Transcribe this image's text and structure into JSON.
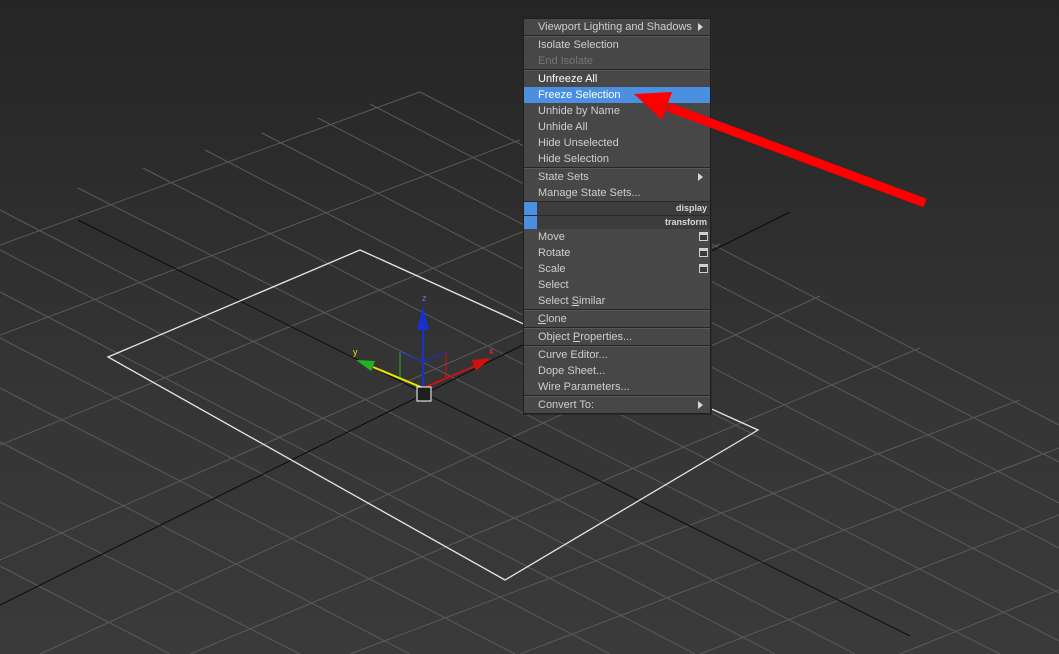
{
  "viewport": {
    "axis_labels": {
      "x": "x",
      "y": "y",
      "z": "z"
    },
    "colors": {
      "grid": "#5a5a5a",
      "world_axis": "#0a0a0a",
      "plane": "#e6e6e6",
      "x_axis": "#d01010",
      "y_axis": "#22b322",
      "z_axis": "#1a2fd0",
      "arrow": "#ff0000"
    }
  },
  "quad_menu": {
    "items": [
      {
        "type": "item",
        "label": "Viewport Lighting and Shadows",
        "submenu": true,
        "state": "normal"
      },
      {
        "type": "sep"
      },
      {
        "type": "item",
        "label": "Isolate Selection",
        "state": "normal"
      },
      {
        "type": "item",
        "label": "End Isolate",
        "state": "disabled"
      },
      {
        "type": "sep"
      },
      {
        "type": "item",
        "label": "Unfreeze All",
        "state": "bright"
      },
      {
        "type": "item",
        "label": "Freeze Selection",
        "state": "highlight"
      },
      {
        "type": "item",
        "label": "Unhide by Name",
        "state": "normal"
      },
      {
        "type": "item",
        "label": "Unhide All",
        "state": "normal"
      },
      {
        "type": "item",
        "label": "Hide Unselected",
        "state": "normal"
      },
      {
        "type": "item",
        "label": "Hide Selection",
        "state": "normal"
      },
      {
        "type": "sep"
      },
      {
        "type": "item",
        "label": "State Sets",
        "submenu": true,
        "state": "normal"
      },
      {
        "type": "item",
        "label": "Manage State Sets...",
        "state": "normal"
      },
      {
        "type": "title",
        "label": "display"
      },
      {
        "type": "title",
        "label": "transform"
      },
      {
        "type": "item",
        "label": "Move",
        "options": true,
        "state": "normal"
      },
      {
        "type": "item",
        "label": "Rotate",
        "options": true,
        "state": "normal"
      },
      {
        "type": "item",
        "label": "Scale",
        "options": true,
        "state": "normal"
      },
      {
        "type": "item",
        "label": "Select",
        "state": "normal"
      },
      {
        "type": "item",
        "label": "Select Similar",
        "state": "normal",
        "underline": 7
      },
      {
        "type": "sep"
      },
      {
        "type": "item",
        "label": "Clone",
        "state": "normal",
        "underline": 0
      },
      {
        "type": "sep"
      },
      {
        "type": "item",
        "label": "Object Properties...",
        "state": "normal",
        "underline": 7
      },
      {
        "type": "sep"
      },
      {
        "type": "item",
        "label": "Curve Editor...",
        "state": "normal"
      },
      {
        "type": "item",
        "label": "Dope Sheet...",
        "state": "normal"
      },
      {
        "type": "item",
        "label": "Wire Parameters...",
        "state": "normal"
      },
      {
        "type": "sep"
      },
      {
        "type": "item",
        "label": "Convert To:",
        "submenu": true,
        "state": "normal"
      }
    ]
  }
}
